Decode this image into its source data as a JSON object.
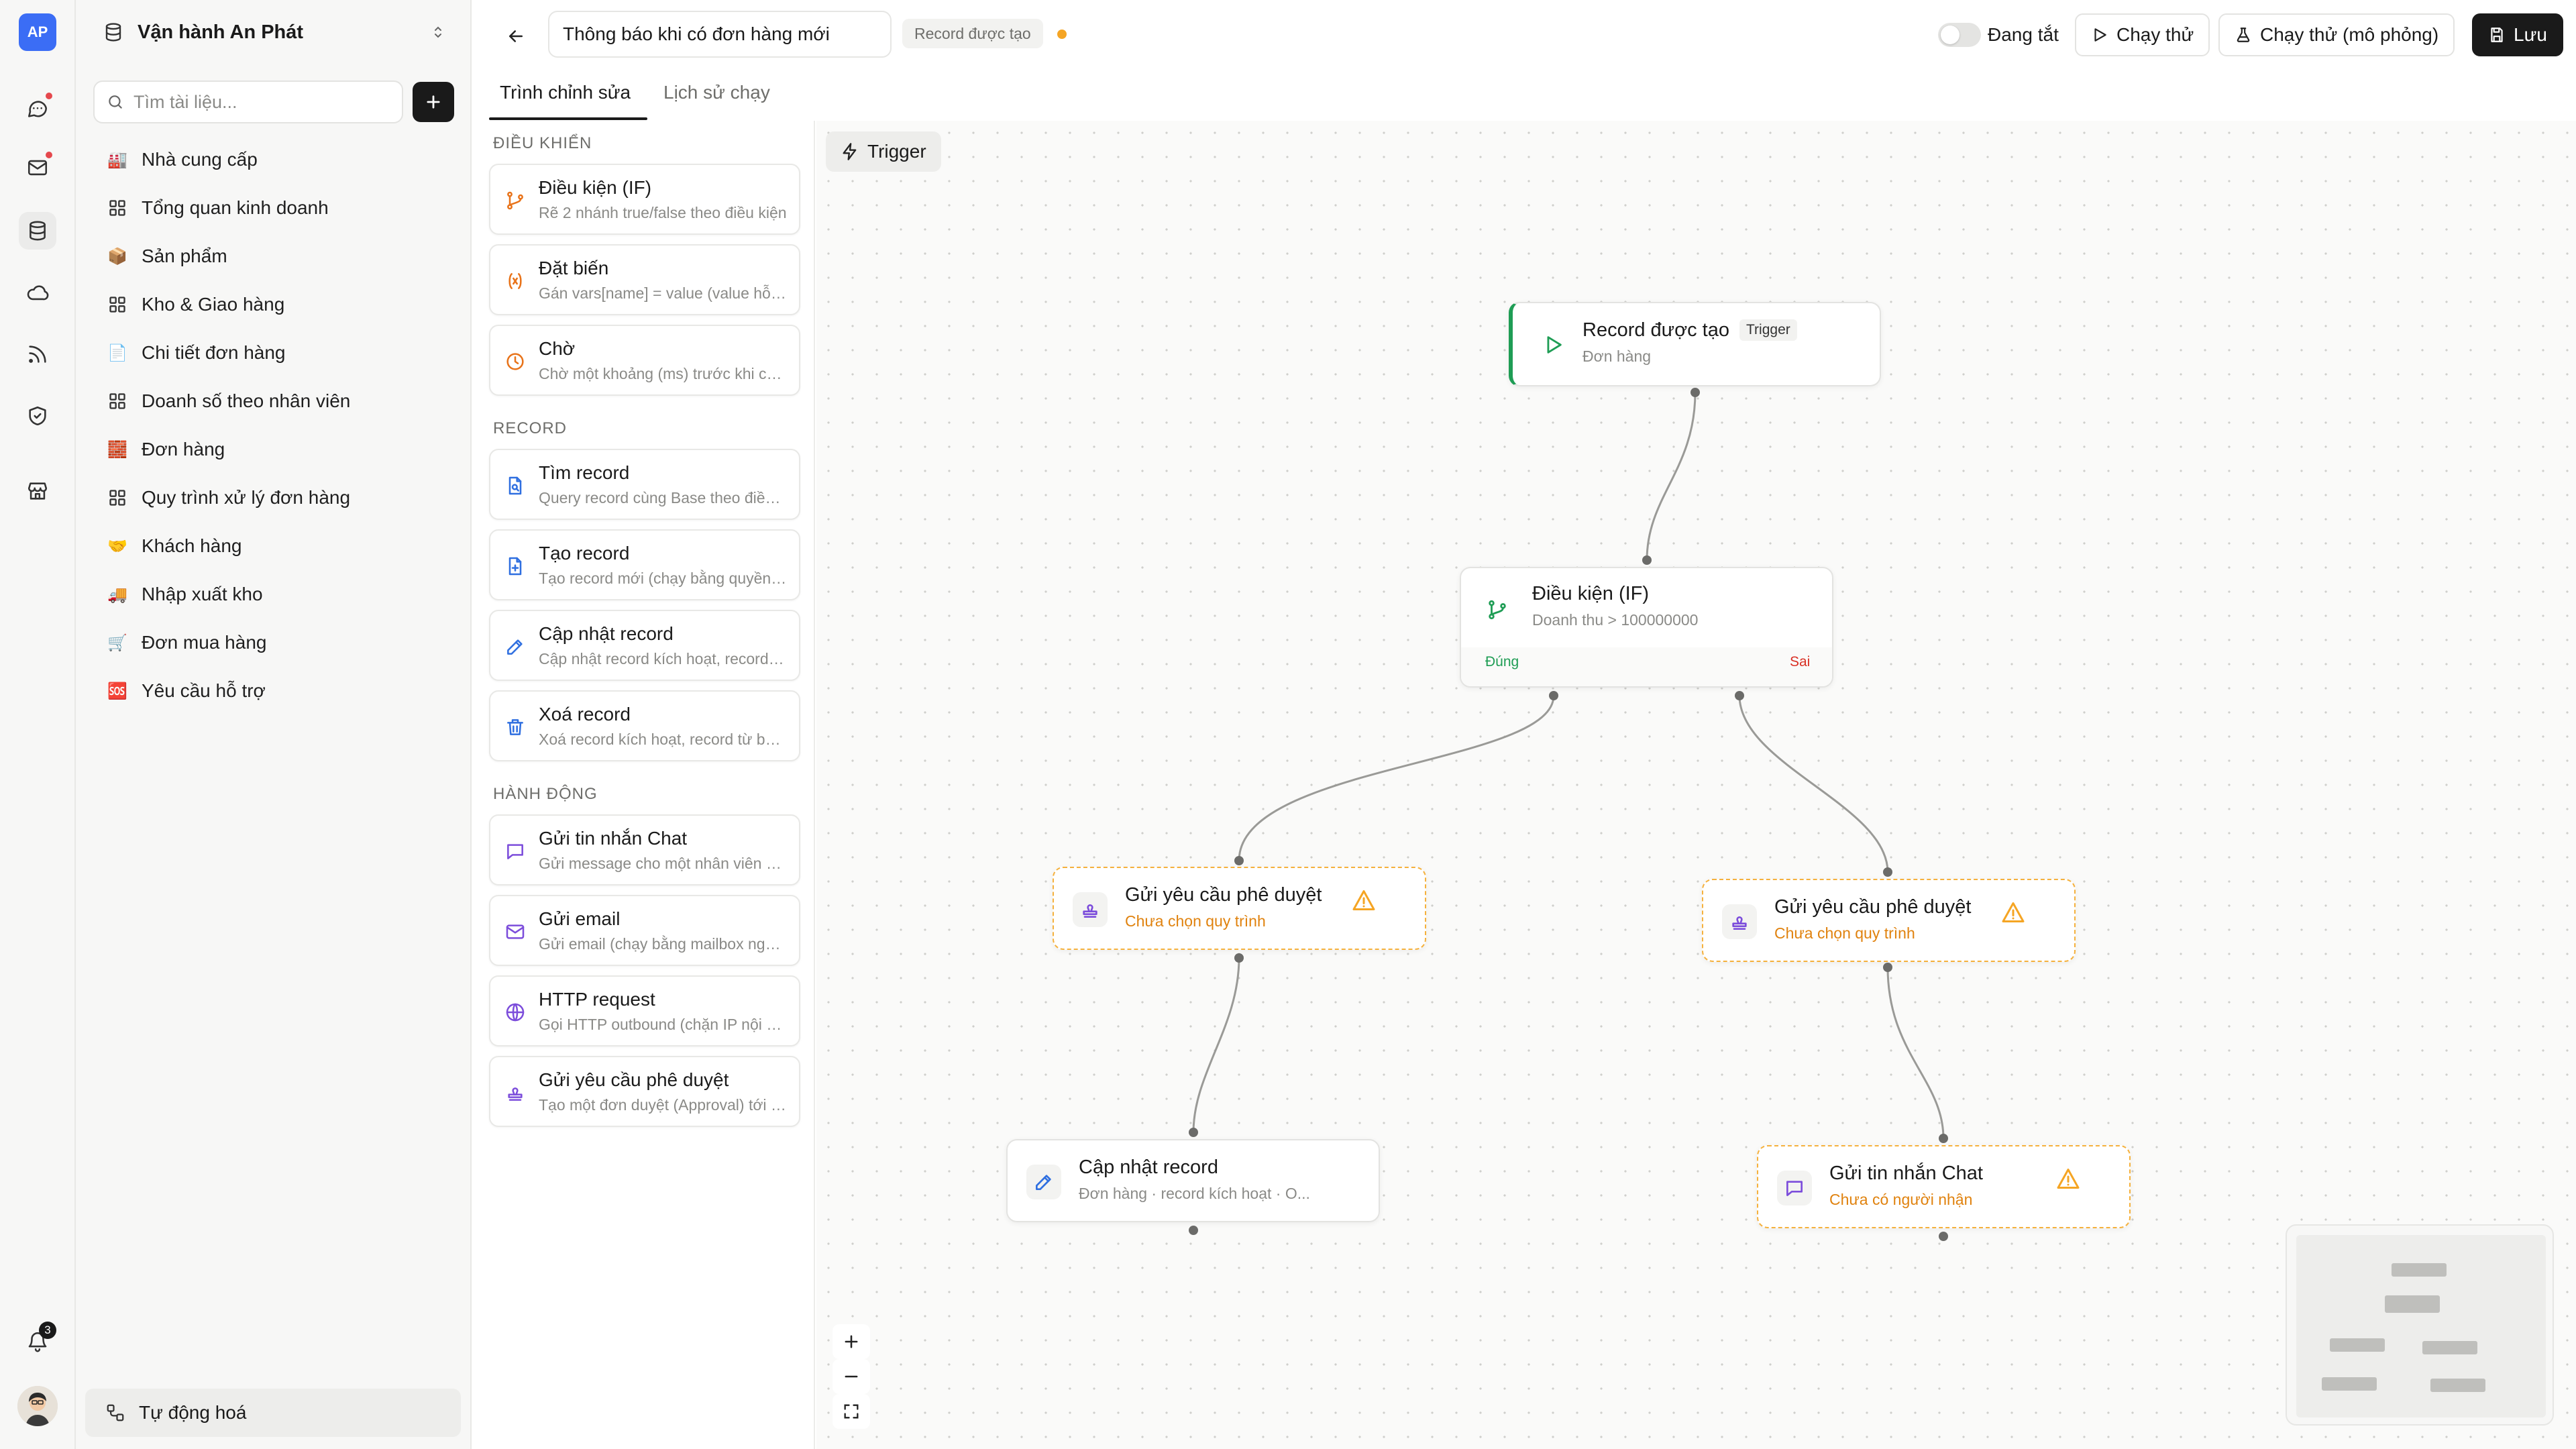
{
  "rail": {
    "logo": "AP",
    "notification_count": "3",
    "icons": [
      "chat-icon",
      "mail-icon",
      "database-icon",
      "cloud-icon",
      "rss-icon",
      "shield-check-icon",
      "store-icon"
    ]
  },
  "sidebar": {
    "workspace_name": "Vận hành An Phát",
    "search_placeholder": "Tìm tài liệu...",
    "items": [
      {
        "label": "Nhà cung cấp",
        "icon": "factory-emoji",
        "glyph": "🏭"
      },
      {
        "label": "Tổng quan kinh doanh",
        "icon": "dashboard-icon",
        "glyph": ""
      },
      {
        "label": "Sản phẩm",
        "icon": "box-emoji",
        "glyph": "📦"
      },
      {
        "label": "Kho & Giao hàng",
        "icon": "dashboard-icon",
        "glyph": ""
      },
      {
        "label": "Chi tiết đơn hàng",
        "icon": "page-emoji",
        "glyph": "📄"
      },
      {
        "label": "Doanh số theo nhân viên",
        "icon": "dashboard-icon",
        "glyph": ""
      },
      {
        "label": "Đơn hàng",
        "icon": "bricks-emoji",
        "glyph": "🧱"
      },
      {
        "label": "Quy trình xử lý đơn hàng",
        "icon": "dashboard-icon",
        "glyph": ""
      },
      {
        "label": "Khách hàng",
        "icon": "handshake-emoji",
        "glyph": "🤝"
      },
      {
        "label": "Nhập xuất kho",
        "icon": "truck-emoji",
        "glyph": "🚚"
      },
      {
        "label": "Đơn mua hàng",
        "icon": "cart-emoji",
        "glyph": "🛒"
      },
      {
        "label": "Yêu cầu hỗ trợ",
        "icon": "sos-emoji",
        "glyph": "🆘"
      }
    ],
    "footer_label": "Tự động hoá"
  },
  "topbar": {
    "workflow_title": "Thông báo khi có đơn hàng mới",
    "trigger_chip": "Record được tạo",
    "status_color": "#f5a524",
    "toggle_label": "Đang tắt",
    "run_label": "Chạy thử",
    "simulate_label": "Chạy thử (mô phỏng)",
    "save_label": "Lưu"
  },
  "tabs": [
    {
      "label": "Trình chỉnh sửa",
      "active": true
    },
    {
      "label": "Lịch sử chạy",
      "active": false
    }
  ],
  "palette": {
    "sections": [
      {
        "title": "ĐIỀU KHIỂN",
        "items": [
          {
            "title": "Điều kiện (IF)",
            "desc": "Rẽ 2 nhánh true/false theo điều kiện",
            "icon": "branch-icon",
            "color": "#e8731a"
          },
          {
            "title": "Đặt biến",
            "desc": "Gán vars[name] = value (value hỗ trợ template)",
            "icon": "variable-icon",
            "color": "#e8731a"
          },
          {
            "title": "Chờ",
            "desc": "Chờ một khoảng (ms) trước khi chạy tiếp",
            "icon": "clock-icon",
            "color": "#e8731a"
          }
        ]
      },
      {
        "title": "RECORD",
        "items": [
          {
            "title": "Tìm record",
            "desc": "Query record cùng Base theo điều kiện",
            "icon": "file-search-icon",
            "color": "#2f6fe0"
          },
          {
            "title": "Tạo record",
            "desc": "Tạo record mới (chạy bằng quyền của người tạo)",
            "icon": "file-plus-icon",
            "color": "#2f6fe0"
          },
          {
            "title": "Cập nhật record",
            "desc": "Cập nhật record kích hoạt, record khác",
            "icon": "pencil-icon",
            "color": "#2f6fe0"
          },
          {
            "title": "Xoá record",
            "desc": "Xoá record kích hoạt, record từ bước trước",
            "icon": "trash-icon",
            "color": "#2f6fe0"
          }
        ]
      },
      {
        "title": "HÀNH ĐỘNG",
        "items": [
          {
            "title": "Gửi tin nhắn Chat",
            "desc": "Gửi message cho một nhân viên hoặc nhóm",
            "icon": "message-icon",
            "color": "#7c4ddb"
          },
          {
            "title": "Gửi email",
            "desc": "Gửi email (chạy bằng mailbox người tạo)",
            "icon": "mail-icon",
            "color": "#7c4ddb"
          },
          {
            "title": "HTTP request",
            "desc": "Gọi HTTP outbound (chặn IP nội bộ)",
            "icon": "globe-icon",
            "color": "#7c4ddb"
          },
          {
            "title": "Gửi yêu cầu phê duyệt",
            "desc": "Tạo một đơn duyệt (Approval) tới người duyệt",
            "icon": "stamp-icon",
            "color": "#7c4ddb"
          }
        ]
      }
    ]
  },
  "canvas": {
    "trigger_button": "Trigger",
    "nodes": {
      "trigger": {
        "title": "Record được tạo",
        "subtitle": "Đơn hàng",
        "badge": "Trigger",
        "accent": "#1f9d55"
      },
      "condition": {
        "title": "Điều kiện (IF)",
        "subtitle": "Doanh thu > 100000000",
        "true_label": "Đúng",
        "false_label": "Sai",
        "true_color": "#1f9d55",
        "false_color": "#d93025"
      },
      "approval_true": {
        "title": "Gửi yêu cầu phê duyệt",
        "subtitle": "Chưa chọn quy trình"
      },
      "approval_false": {
        "title": "Gửi yêu cầu phê duyệt",
        "subtitle": "Chưa chọn quy trình"
      },
      "update_record": {
        "title": "Cập nhật record",
        "subtitle": "Đơn hàng · record kích hoạt · O..."
      },
      "send_chat": {
        "title": "Gửi tin nhắn Chat",
        "subtitle": "Chưa có người nhận"
      }
    },
    "warning_color": "#f5b13d"
  }
}
